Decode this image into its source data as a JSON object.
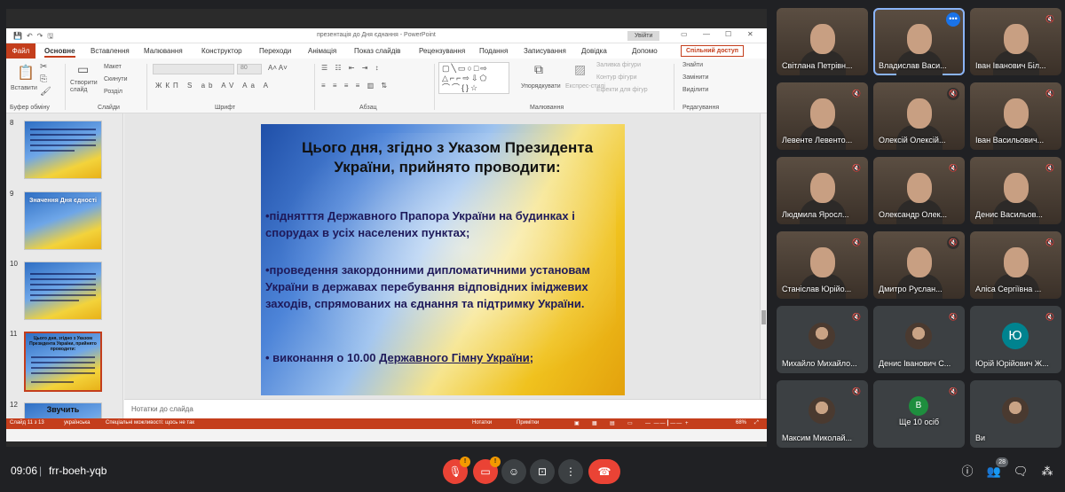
{
  "powerpoint": {
    "document_title": "презентація до Дня єднання - PowerPoint",
    "sign_in": "Увійти",
    "tabs": [
      "Файл",
      "Основне",
      "Вставлення",
      "Малювання",
      "Конструктор",
      "Переходи",
      "Анімація",
      "Показ слайдів",
      "Рецензування",
      "Подання",
      "Записування",
      "Довідка",
      "Допомо"
    ],
    "share_button": "Спільний доступ",
    "ribbon": {
      "paste": "Вставити",
      "new_slide": "Створити слайд",
      "layout": "Макет",
      "reset": "Скинути",
      "section": "Розділ",
      "font_size": "80",
      "arrange": "Упорядкувати",
      "express_styles": "Експрес-стилі",
      "shape_fill": "Заливка фігури",
      "shape_outline": "Контур фігури",
      "shape_effects": "Ефекти для фігур",
      "find": "Знайти",
      "replace": "Замінити",
      "select": "Виділити",
      "groups": [
        "Буфер обміну",
        "Слайди",
        "Шрифт",
        "Абзац",
        "Малювання",
        "Редагування"
      ]
    },
    "thumbnails": [
      {
        "number": "8",
        "title": ""
      },
      {
        "number": "9",
        "title": "Значення Дня єдності"
      },
      {
        "number": "10",
        "title": ""
      },
      {
        "number": "11",
        "title": "Цього дня, згідно з Указом Президента України, прийнято проводити:"
      },
      {
        "number": "12",
        "title": "Звучить"
      }
    ],
    "slide": {
      "title": "Цього дня, згідно з Указом Президента України, прийнято проводити:",
      "bullet1": "•піднятття Державного Прапора України на будинках і спорудах в усіх населених пунктах;",
      "bullet2": "•проведення закордонними дипломатичними установам України в державах перебування відповідних іміджевих заходів, спрямованих на єднання та підтримку України.",
      "bullet3_prefix": "• виконання о 10.00 ",
      "bullet3_link": "Державного Гімну України",
      "bullet3_suffix": ";"
    },
    "notes_placeholder": "Нотатки до слайда",
    "status": {
      "slide": "Слайд 11 з 13",
      "language": "українська",
      "accessibility": "Спеціальні можливості: щось не так",
      "notes": "Нотатки",
      "comments": "Примітки",
      "zoom": "68%"
    }
  },
  "participants": [
    {
      "name": "Світлана Петрівн...",
      "muted": false,
      "type": "video"
    },
    {
      "name": "Владислав Васи...",
      "muted": false,
      "type": "video",
      "selected": true
    },
    {
      "name": "Іван Іванович Біл...",
      "muted": true,
      "type": "video"
    },
    {
      "name": "Левенте Левенто...",
      "muted": true,
      "type": "video"
    },
    {
      "name": "Олексій Олексій...",
      "muted": true,
      "type": "video"
    },
    {
      "name": "Іван Васильович...",
      "muted": true,
      "type": "video"
    },
    {
      "name": "Людмила Яросл...",
      "muted": true,
      "type": "video"
    },
    {
      "name": "Олександр Олек...",
      "muted": true,
      "type": "video"
    },
    {
      "name": "Денис Васильов...",
      "muted": true,
      "type": "video"
    },
    {
      "name": "Станіслав Юрійо...",
      "muted": true,
      "type": "video"
    },
    {
      "name": "Дмитро Руслан...",
      "muted": true,
      "type": "video"
    },
    {
      "name": "Аліса Сергіївна ...",
      "muted": true,
      "type": "video"
    },
    {
      "name": "Михайло Михайло...",
      "muted": true,
      "type": "avatar"
    },
    {
      "name": "Денис Іванович С...",
      "muted": true,
      "type": "avatar"
    },
    {
      "name": "Юрій Юрійович Ж...",
      "muted": true,
      "type": "letter",
      "letter": "Ю",
      "color": "#00838f"
    },
    {
      "name": "Максим Миколай...",
      "muted": true,
      "type": "avatar"
    },
    {
      "name": "Ще 10 осіб",
      "muted": true,
      "type": "group",
      "letter": "В",
      "color": "#1e8e3e"
    },
    {
      "name": "Ви",
      "muted": false,
      "type": "avatar"
    }
  ],
  "bottom_bar": {
    "time": "09:06",
    "separator": "|",
    "meeting_code": "frr-boeh-yqb",
    "mic_warning": "!",
    "cam_warning": "!",
    "people_count": "28"
  },
  "colors": {
    "powerpoint_accent": "#c43e1c",
    "meet_background": "#202124",
    "end_call": "#ea4335"
  }
}
